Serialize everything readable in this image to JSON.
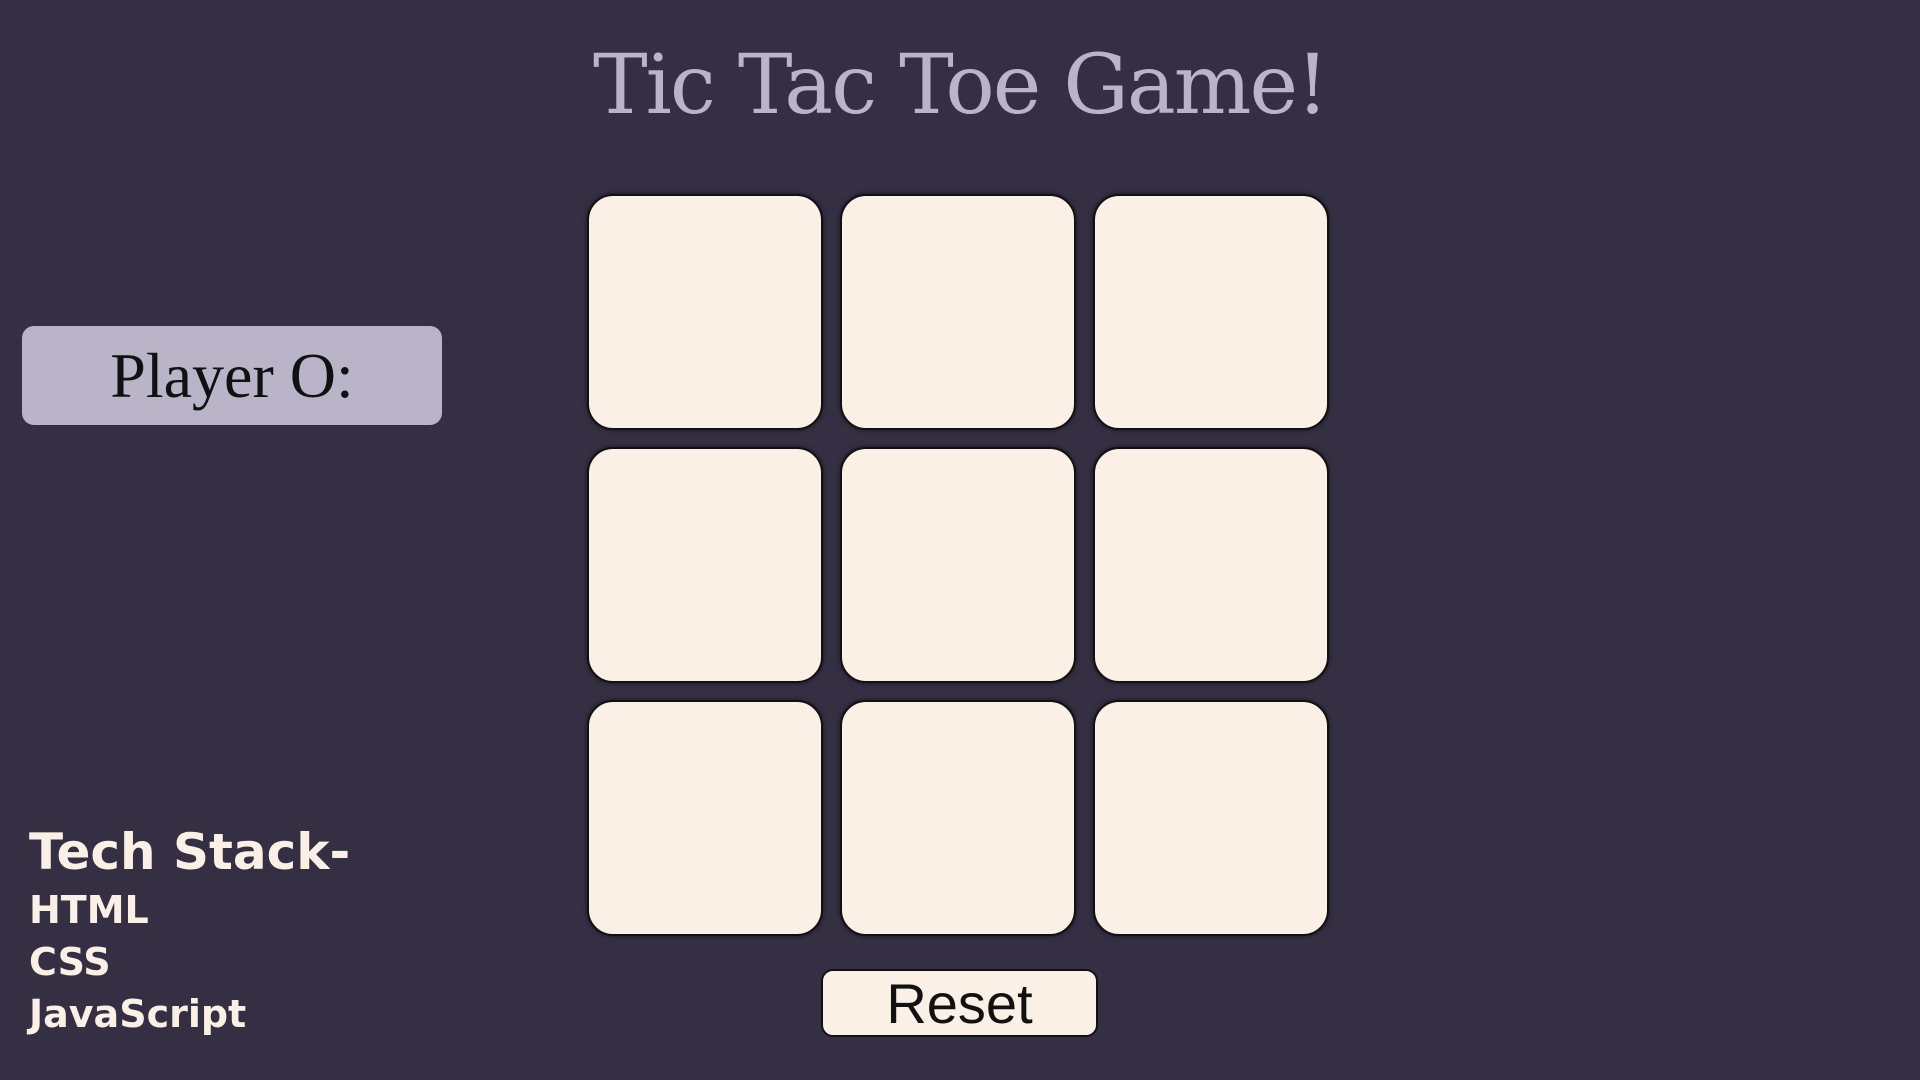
{
  "game": {
    "title": "Tic Tac Toe Game!",
    "turn_label": "Player O:",
    "board": [
      "",
      "",
      "",
      "",
      "",
      "",
      "",
      "",
      ""
    ],
    "reset_label": "Reset"
  },
  "tech_stack": {
    "title": "Tech Stack-",
    "items": [
      "HTML",
      "CSS",
      "JavaScript"
    ]
  },
  "colors": {
    "background": "#352f44",
    "accent": "#b9b4c7",
    "cell": "#faf0e6",
    "text_light": "#faf0e6",
    "text_dark": "#111111"
  }
}
